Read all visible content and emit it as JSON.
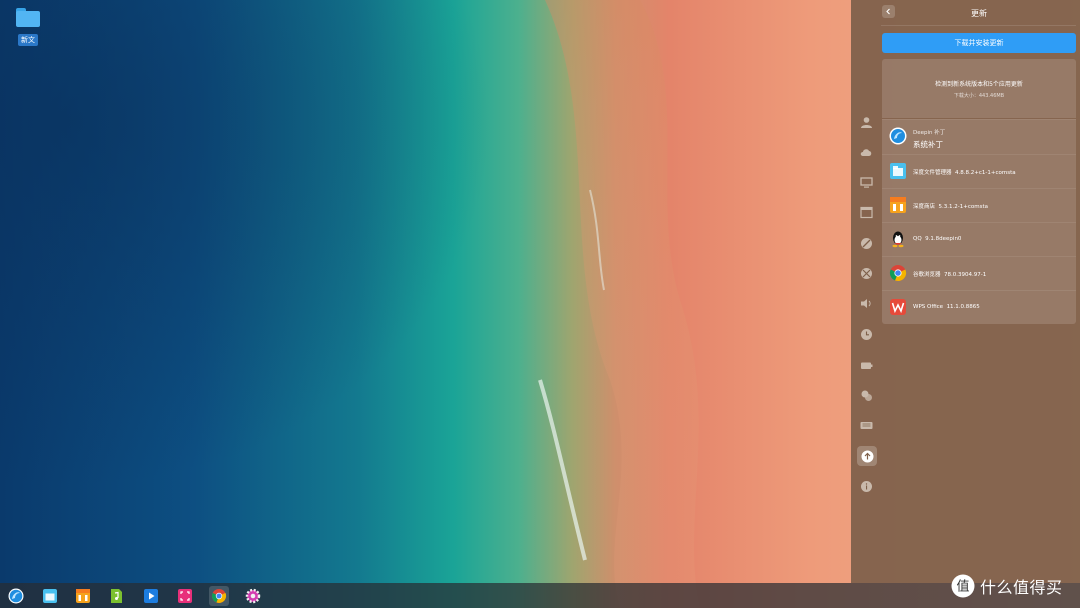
{
  "desktop": {
    "folder_label": "新文"
  },
  "control_center": {
    "title": "更新",
    "install_button": "下载并安装更新",
    "summary": {
      "message": "检测到新系统版本和5个应用更新",
      "size": "下载大小：443.46MB"
    },
    "updates": [
      {
        "title": "Deepin 补丁",
        "subtitle": "系统补丁",
        "icon": "deepin-icon"
      },
      {
        "name": "深度文件管理器",
        "version": "4.8.8.2+c1-1+comsta",
        "icon": "file-manager-icon"
      },
      {
        "name": "深度商店",
        "version": "5.3.1.2-1+comsta",
        "icon": "app-store-icon"
      },
      {
        "name": "QQ",
        "version": "9.1.8deepin0",
        "icon": "qq-icon"
      },
      {
        "name": "谷歌浏览器",
        "version": "78.0.3904.97-1",
        "icon": "chrome-icon"
      },
      {
        "name": "WPS Office",
        "version": "11.1.0.8865",
        "icon": "wps-icon"
      }
    ],
    "sidebar": [
      "accounts-icon",
      "cloud-icon",
      "display-icon",
      "default-apps-icon",
      "personalization-icon",
      "network-icon",
      "sound-icon",
      "datetime-icon",
      "power-icon",
      "mouse-icon",
      "keyboard-icon",
      "update-icon",
      "system-info-icon"
    ]
  },
  "watermark": {
    "text": "什么值得买",
    "badge": "值"
  },
  "colors": {
    "accent": "#2f9df6",
    "panel": "#7e604a"
  }
}
